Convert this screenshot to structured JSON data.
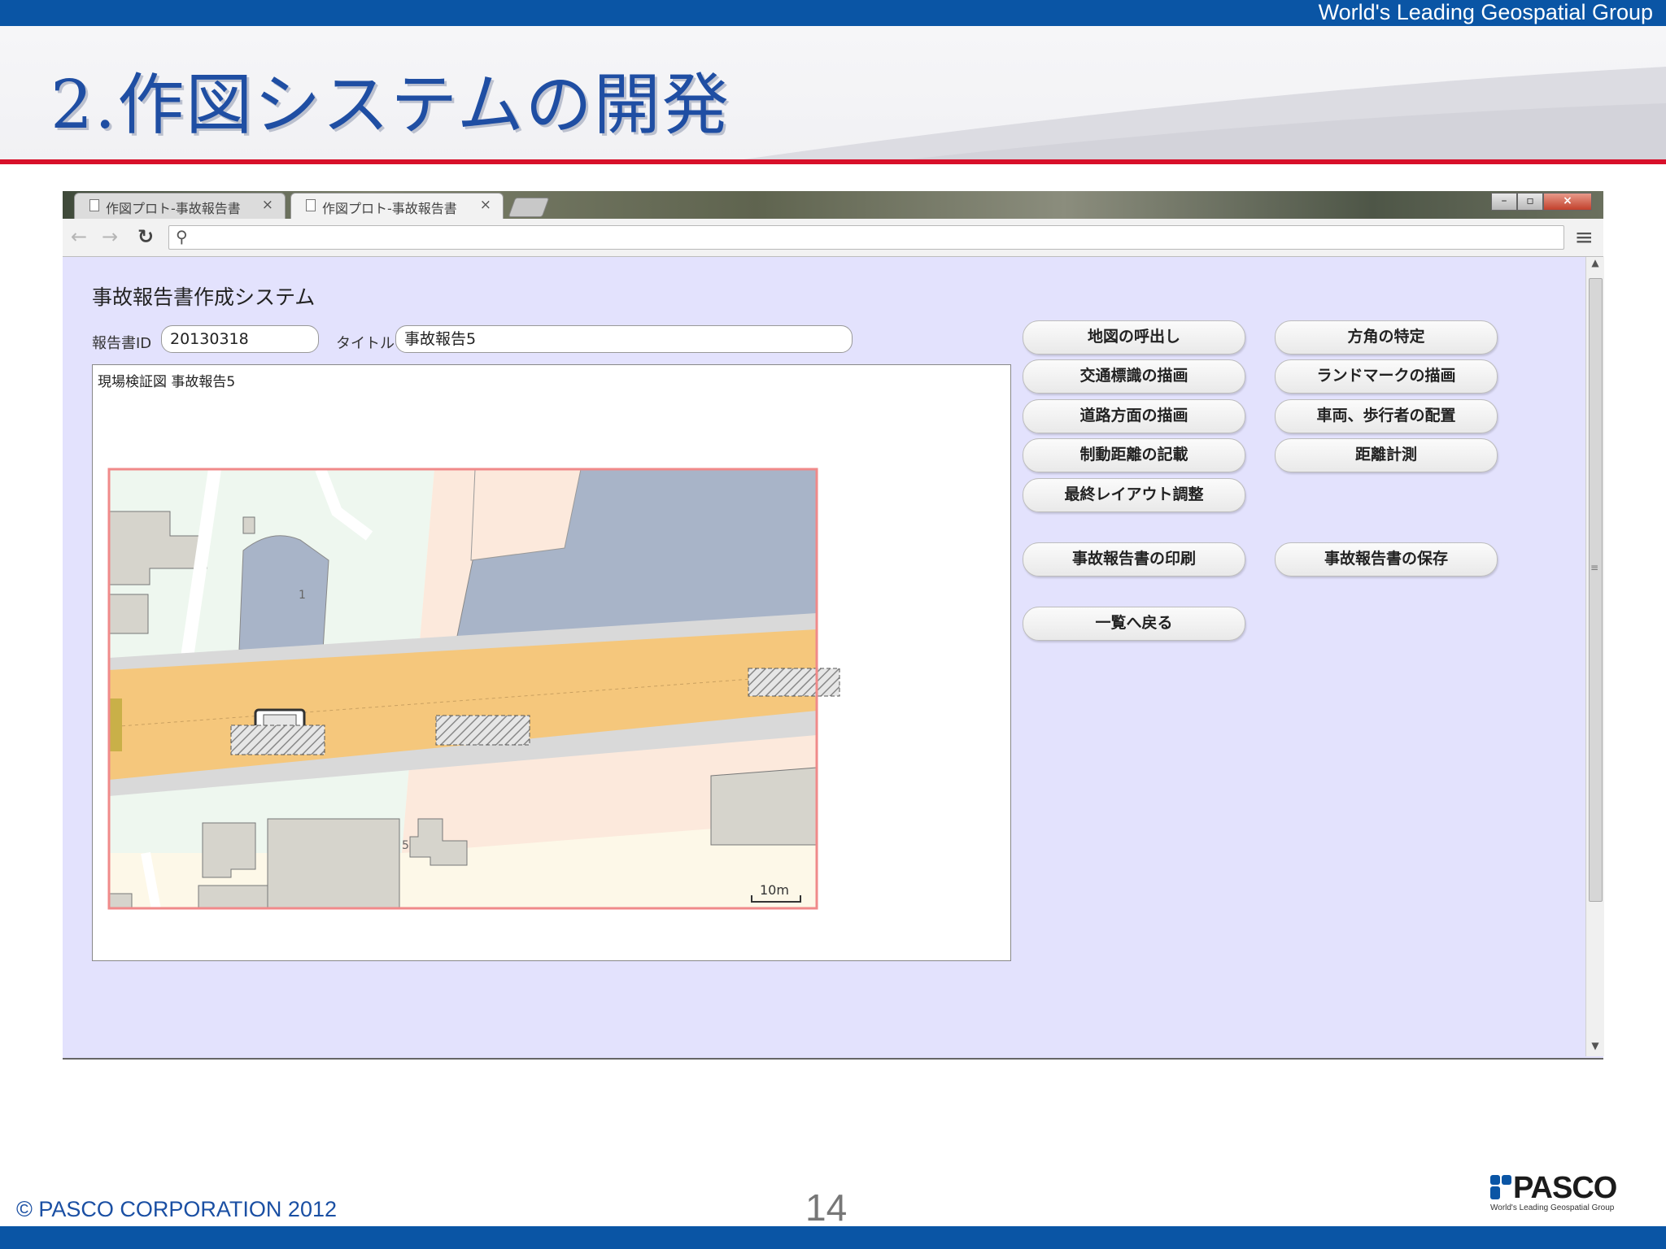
{
  "slide": {
    "tagline": "World's Leading Geospatial Group",
    "title": "2.作図システムの開発",
    "copyright": "© PASCO CORPORATION 2012",
    "page_number": "14",
    "logo": {
      "word": "PASCO",
      "subtitle": "World's Leading Geospatial Group"
    }
  },
  "browser": {
    "tabs": [
      {
        "label": "作図プロト-事故報告書",
        "active": false
      },
      {
        "label": "作図プロト-事故報告書",
        "active": true
      }
    ],
    "window_controls": [
      "minimize-icon",
      "maximize-icon",
      "close-icon"
    ],
    "address": ""
  },
  "app": {
    "title": "事故報告書作成システム",
    "report_id_label": "報告書ID",
    "report_id_value": "20130318",
    "title_label": "タイトル",
    "title_value": "事故報告5",
    "map_caption": "現場検証図 事故報告5",
    "map_labels": {
      "building_1": "1",
      "building_5": "5",
      "scale": "10m"
    },
    "buttons": {
      "map_call": "地図の呼出し",
      "direction": "方角の特定",
      "traffic_sign": "交通標識の描画",
      "landmark": "ランドマークの描画",
      "road_direction": "道路方面の描画",
      "vehicle_place": "車両、歩行者の配置",
      "braking_distance": "制動距離の記載",
      "distance_measure": "距離計測",
      "final_layout": "最終レイアウト調整",
      "print_report": "事故報告書の印刷",
      "save_report": "事故報告書の保存",
      "back_to_list": "一覧へ戻る"
    }
  },
  "colors": {
    "brand_blue": "#0a55a5",
    "title_blue": "#1f4ea3",
    "rule_red": "#d8102a",
    "page_bg": "#e3e2fd",
    "road": "#f5c77c",
    "water_building": "#a8b4c8"
  }
}
